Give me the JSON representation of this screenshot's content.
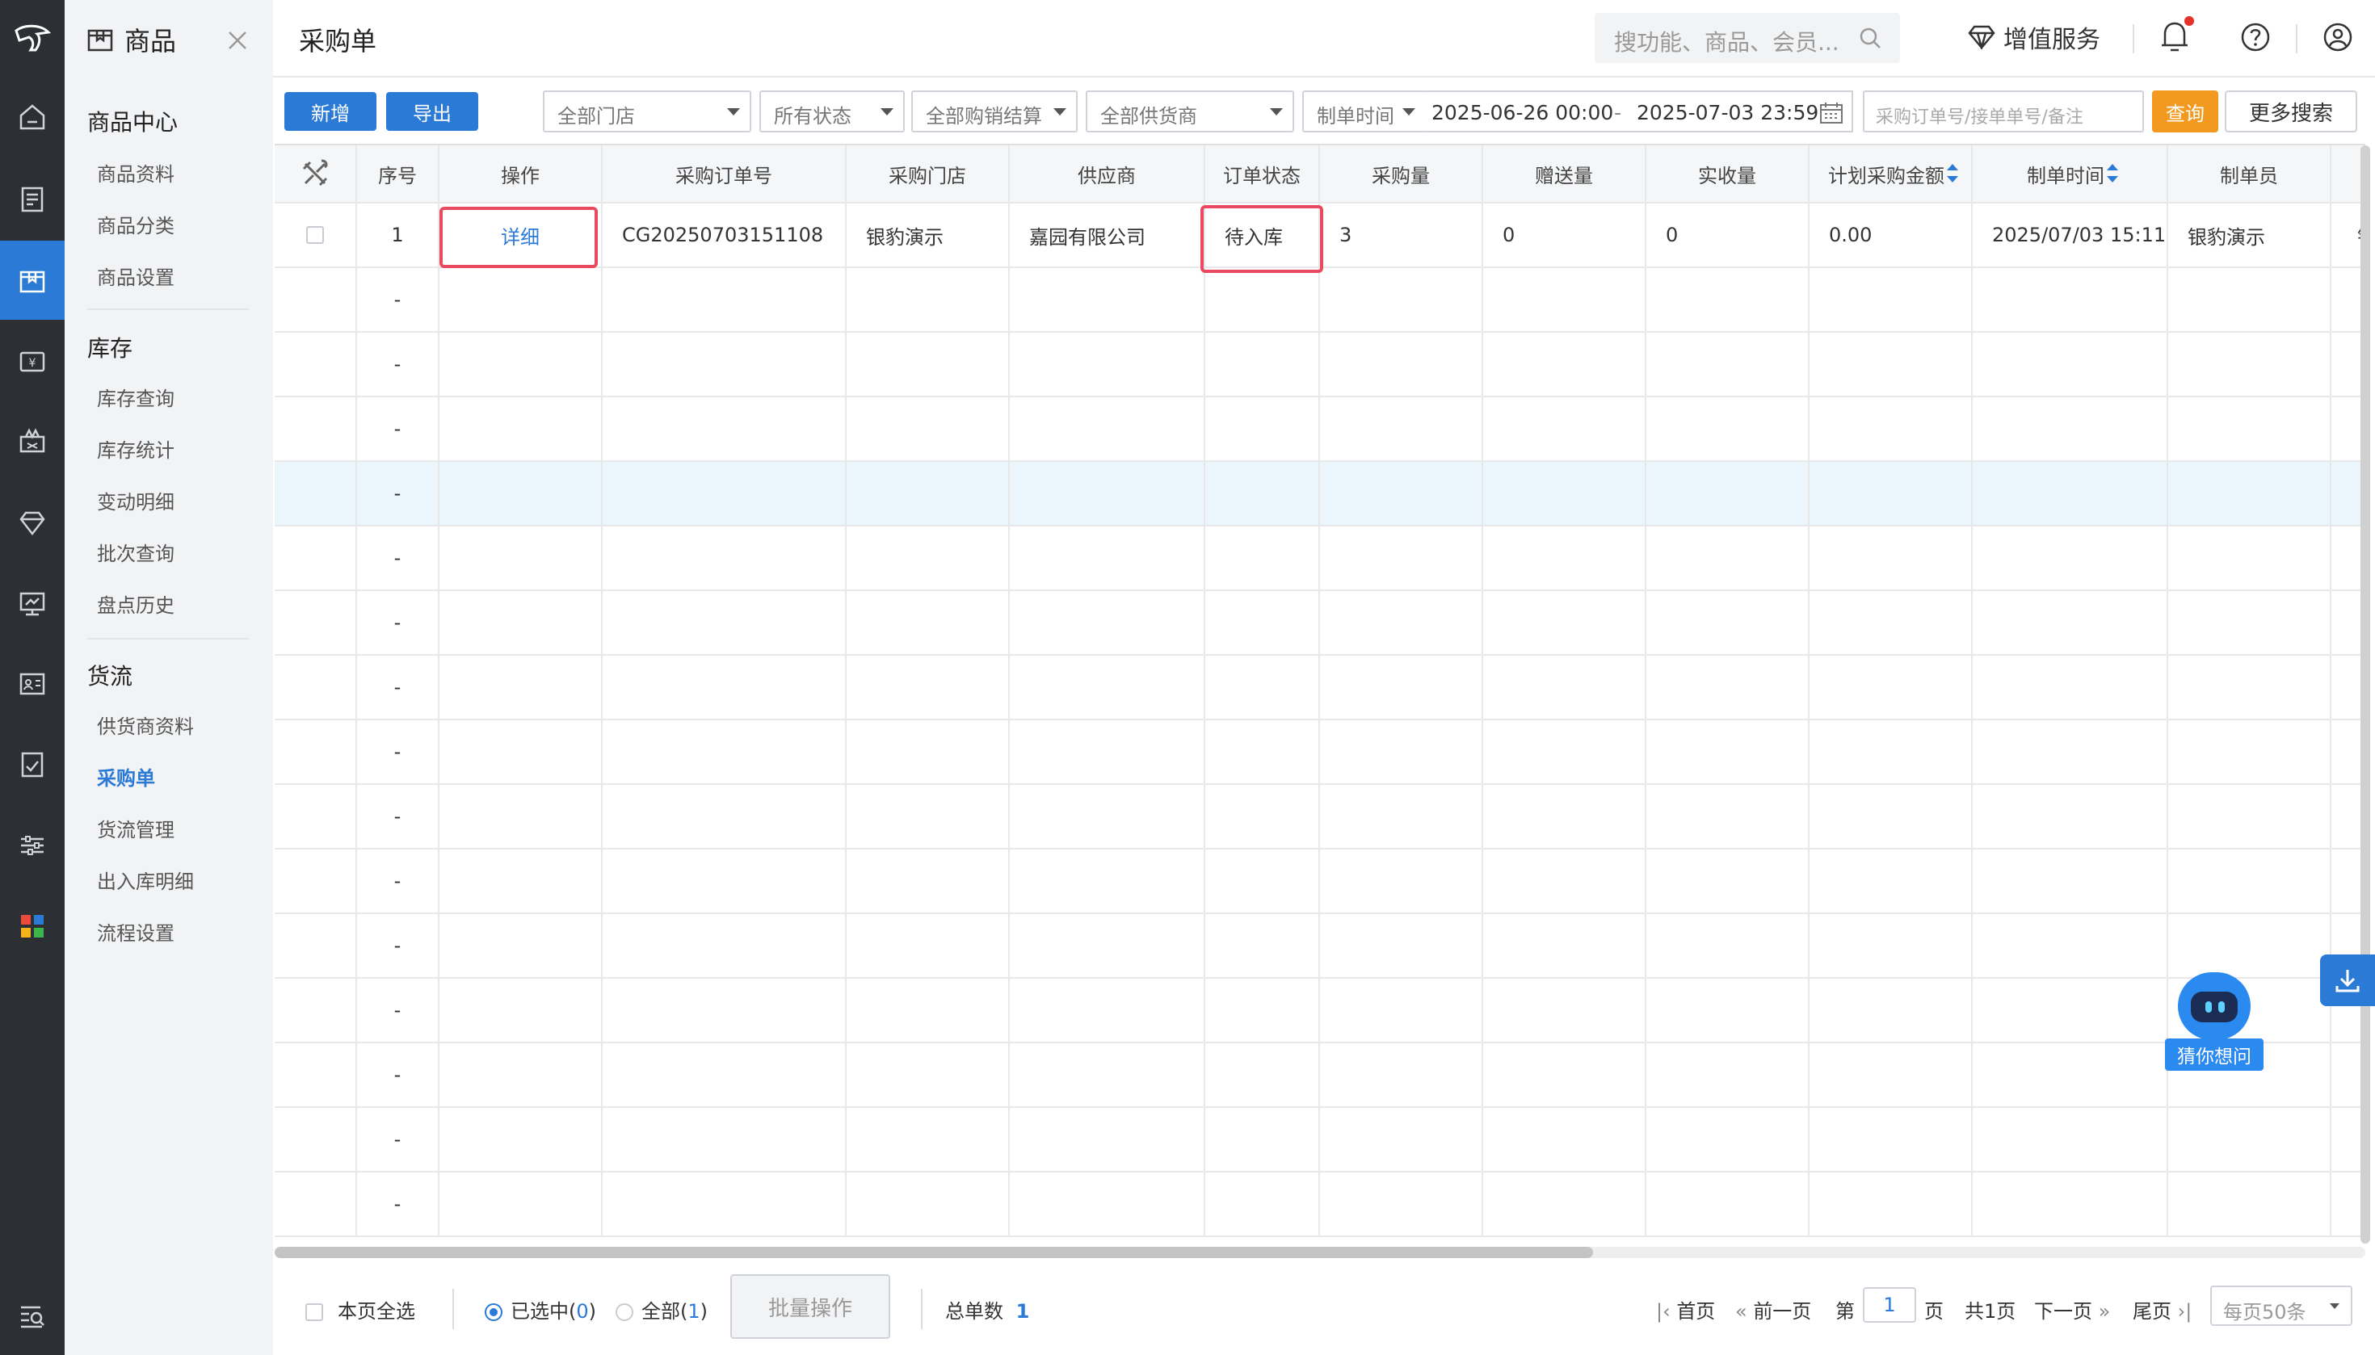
{
  "rail": {
    "icons": [
      "logo-icon",
      "home-icon",
      "receipt-icon",
      "goods-icon",
      "cashier-icon",
      "promotion-icon",
      "member-icon",
      "report-icon",
      "staff-icon",
      "finance-icon",
      "settings-icon",
      "apps-icon",
      "search-menu-icon"
    ]
  },
  "sidebar": {
    "title": "商品",
    "groups": [
      {
        "label": "商品中心",
        "items": [
          "商品资料",
          "商品分类",
          "商品设置"
        ]
      },
      {
        "label": "库存",
        "items": [
          "库存查询",
          "库存统计",
          "变动明细",
          "批次查询",
          "盘点历史"
        ]
      },
      {
        "label": "货流",
        "items": [
          "供货商资料",
          "采购单",
          "货流管理",
          "出入库明细",
          "流程设置"
        ]
      }
    ],
    "active_item": "采购单"
  },
  "header": {
    "page_title": "采购单",
    "search_placeholder": "搜功能、商品、会员...",
    "value_service": "增值服务"
  },
  "toolbar": {
    "add": "新增",
    "export": "导出",
    "store_filter": "全部门店",
    "status_filter": "所有状态",
    "settle_filter": "全部购销结算",
    "supplier_filter": "全部供货商",
    "time_type": "制单时间",
    "date_start": "2025-06-26 00:00",
    "date_sep": "-",
    "date_end": "2025-07-03 23:59",
    "keyword_placeholder": "采购订单号/接单单号/备注",
    "query": "查询",
    "more_search": "更多搜索"
  },
  "table": {
    "columns": [
      "序号",
      "操作",
      "采购订单号",
      "采购门店",
      "供应商",
      "订单状态",
      "采购量",
      "赠送量",
      "实收量",
      "计划采购金额",
      "制单时间",
      "制单员"
    ],
    "rows": [
      {
        "index": "1",
        "action": "详细",
        "order_no": "CG20250703151108",
        "store": "银豹演示",
        "supplier": "嘉园有限公司",
        "status": "待入库",
        "qty": "3",
        "gift_qty": "0",
        "received_qty": "0",
        "plan_amount": "0.00",
        "created_at": "2025/07/03 15:11",
        "creator": "银豹演示",
        "extra": "银"
      }
    ],
    "empty_row_marker": "-"
  },
  "footer": {
    "select_page": "本页全选",
    "selected_label": "已选中(",
    "selected_count": "0",
    "all_label": "全部(",
    "all_count": "1",
    "close_paren": ")",
    "batch": "批量操作",
    "total_label": "总单数",
    "total": "1",
    "first": "首页",
    "prev": "前一页",
    "page_prefix": "第",
    "page": "1",
    "page_suffix": "页",
    "page_count": "共1页",
    "next": "下一页",
    "last": "尾页",
    "page_size": "每页50条"
  },
  "assistant": {
    "label": "猜你想问"
  },
  "colors": {
    "primary": "#2b7ad6",
    "query": "#f19a1f",
    "highlight_box": "#e94a5f",
    "rail": "#2c2f33"
  }
}
